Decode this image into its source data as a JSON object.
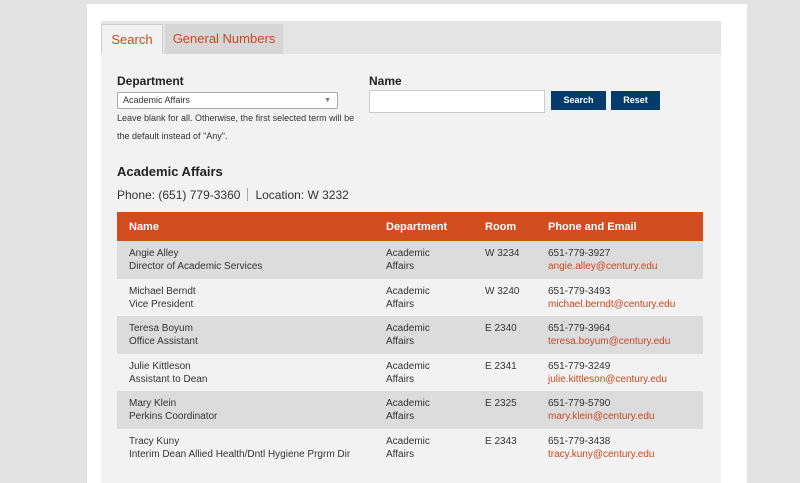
{
  "tabs": [
    "Search",
    "General Numbers"
  ],
  "form": {
    "department_label": "Department",
    "department_value": "Academic Affairs",
    "help_text": "Leave blank for all. Otherwise, the first selected term will be the default instead of \"Any\".",
    "name_label": "Name",
    "name_value": "",
    "search_label": "Search",
    "reset_label": "Reset"
  },
  "department": {
    "title": "Academic Affairs",
    "phone_text": "Phone: (651) 779-3360",
    "location_text": "Location: W 3232"
  },
  "table": {
    "headers": [
      "Name",
      "Department",
      "Room",
      "Phone and Email"
    ],
    "rows": [
      {
        "name": "Angie Alley",
        "title": "Director of Academic Services",
        "dept1": "Academic",
        "dept2": "Affairs",
        "room": "W 3234",
        "phone": "651-779-3927",
        "email": "angie.alley@century.edu"
      },
      {
        "name": "Michael Berndt",
        "title": "Vice President",
        "dept1": "Academic",
        "dept2": "Affairs",
        "room": "W 3240",
        "phone": "651-779-3493",
        "email": "michael.berndt@century.edu"
      },
      {
        "name": "Teresa Boyum",
        "title": "Office Assistant",
        "dept1": "Academic",
        "dept2": "Affairs",
        "room": "E 2340",
        "phone": "651-779-3964",
        "email": "teresa.boyum@century.edu"
      },
      {
        "name": "Julie Kittleson",
        "title": "Assistant to Dean",
        "dept1": "Academic",
        "dept2": "Affairs",
        "room": "E 2341",
        "phone": "651-779-3249",
        "email": "julie.kittleson@century.edu"
      },
      {
        "name": "Mary Klein",
        "title": "Perkins Coordinator",
        "dept1": "Academic",
        "dept2": "Affairs",
        "room": "E 2325",
        "phone": "651-779-5790",
        "email": "mary.klein@century.edu"
      },
      {
        "name": "Tracy Kuny",
        "title": "Interim Dean Allied Health/Dntl Hygiene Prgrm Dir",
        "dept1": "Academic",
        "dept2": "Affairs",
        "room": "E 2343",
        "phone": "651-779-3438",
        "email": "tracy.kuny@century.edu"
      }
    ]
  }
}
